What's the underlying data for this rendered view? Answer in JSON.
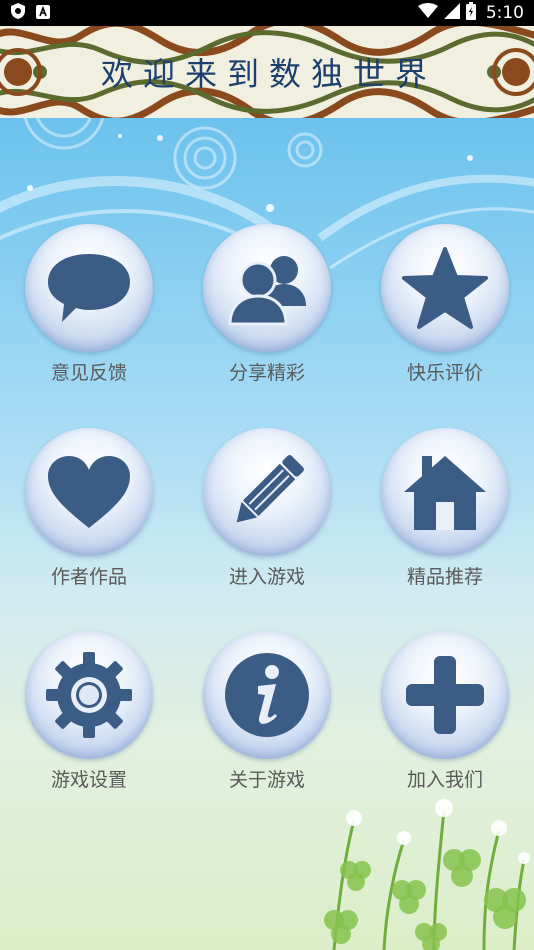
{
  "status_bar": {
    "time": "5:10",
    "icons": [
      "shield-app-icon",
      "a-app-icon",
      "wifi-icon",
      "signal-icon",
      "battery-icon"
    ]
  },
  "banner": {
    "title": "欢迎来到数独世界"
  },
  "menu": {
    "items": [
      {
        "label": "意见反馈",
        "icon": "chat-bubble-icon"
      },
      {
        "label": "分享精彩",
        "icon": "users-icon"
      },
      {
        "label": "快乐评价",
        "icon": "star-icon"
      },
      {
        "label": "作者作品",
        "icon": "heart-icon"
      },
      {
        "label": "进入游戏",
        "icon": "pencil-icon"
      },
      {
        "label": "精品推荐",
        "icon": "house-icon"
      },
      {
        "label": "游戏设置",
        "icon": "gear-icon"
      },
      {
        "label": "关于游戏",
        "icon": "info-icon"
      },
      {
        "label": "加入我们",
        "icon": "plus-icon"
      }
    ]
  },
  "colors": {
    "icon_fill": "#3b5c85",
    "label_text": "#5a5a5a",
    "banner_text": "#1b3f6e",
    "sky_top": "#56b8ea"
  }
}
